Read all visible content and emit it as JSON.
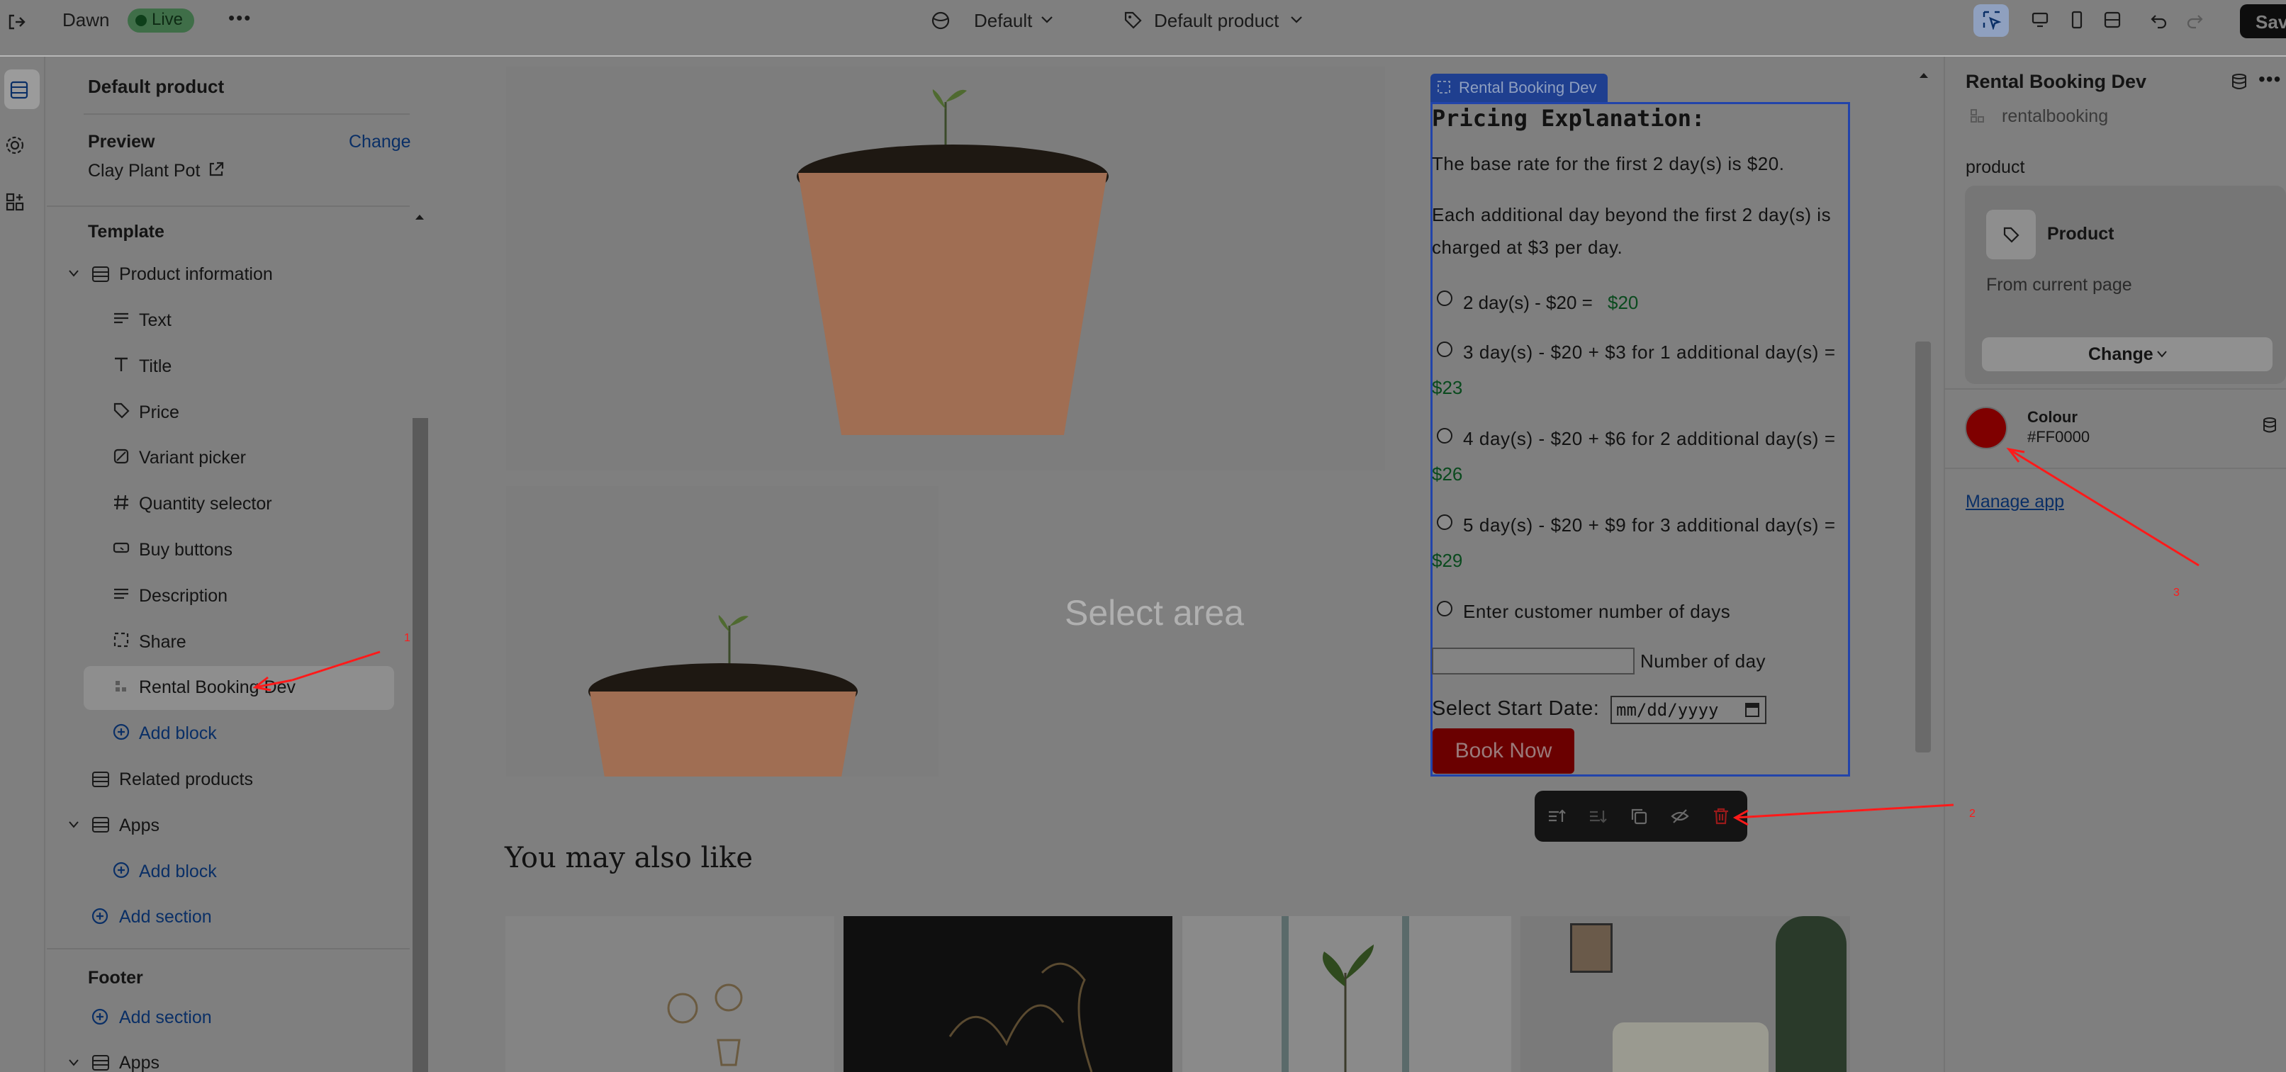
{
  "topbar": {
    "theme_name": "Dawn",
    "status": "Live",
    "more_label": "•••",
    "template_select": "Default",
    "product_select": "Default product",
    "save_label": "Save"
  },
  "sidebar": {
    "heading": "Default product",
    "preview_label": "Preview",
    "change_label": "Change",
    "preview_product": "Clay Plant Pot",
    "template_heading": "Template",
    "section_product_info": "Product information",
    "blocks": [
      "Text",
      "Title",
      "Price",
      "Variant picker",
      "Quantity selector",
      "Buy buttons",
      "Description",
      "Share",
      "Rental Booking Dev"
    ],
    "add_block": "Add block",
    "related_products": "Related products",
    "apps": "Apps",
    "add_block_apps": "Add block",
    "add_section": "Add section",
    "footer_heading": "Footer",
    "footer_add_section": "Add section",
    "footer_apps": "Apps"
  },
  "preview": {
    "select_area": "Select area",
    "block_tag": "Rental Booking Dev",
    "pricing_title": "Pricing Explanation:",
    "base_rate": "The base rate for the first 2 day(s) is $20.",
    "additional_line1": "Each additional day beyond the first 2 day(s) is",
    "additional_line2": "charged at $3 per day.",
    "options": [
      {
        "text": "2 day(s) - $20 = ",
        "price": "$20"
      },
      {
        "text": "3 day(s) - $20 + $3 for 1 additional day(s) =",
        "price": "$23"
      },
      {
        "text": "4 day(s) - $20 + $6 for 2 additional day(s) =",
        "price": "$26"
      },
      {
        "text": "5 day(s) - $20 + $9 for 3 additional day(s) =",
        "price": "$29"
      }
    ],
    "custom_option": "Enter customer number of days",
    "number_of_day_label": "Number of day",
    "start_date_label": "Select Start Date:",
    "date_placeholder": "mm/dd/yyyy",
    "book_now": "Book Now",
    "you_may_also_like": "You may also like"
  },
  "rightpanel": {
    "title": "Rental Booking Dev",
    "subtitle": "rentalbooking",
    "product_label": "product",
    "product_card_title": "Product",
    "product_card_sub": "From current page",
    "change_label": "Change",
    "colour_label": "Colour",
    "colour_value": "#FF0000",
    "manage_app": "Manage app"
  },
  "annotations": [
    "1",
    "2",
    "3"
  ],
  "colors": {
    "accent_blue": "#2244aa",
    "live_green": "#1e8f3a",
    "price_green": "#1a8f3a",
    "book_red": "#cc0000",
    "swatch": "#FF0000",
    "annotation": "#ff1a1a"
  }
}
